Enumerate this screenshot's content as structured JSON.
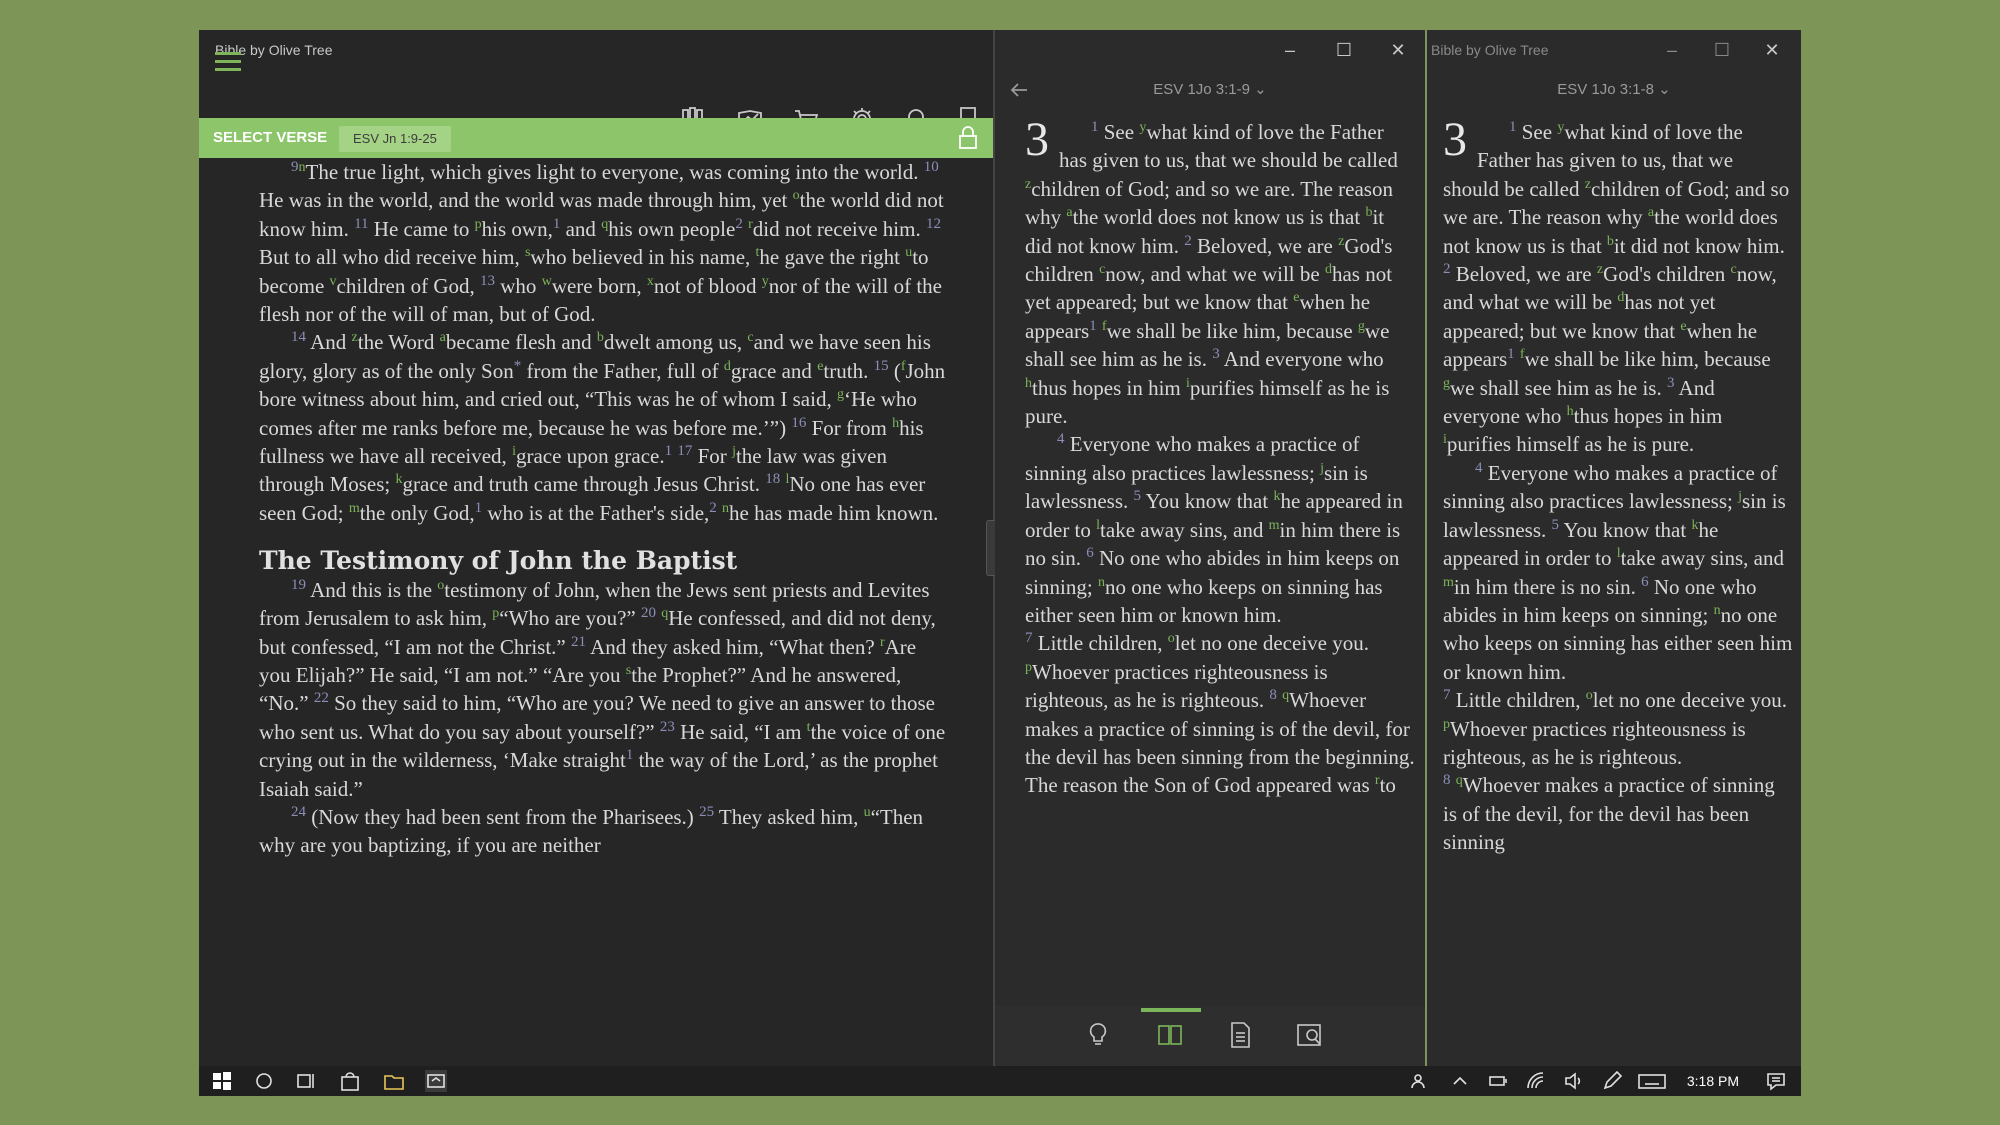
{
  "left_window": {
    "title": "Bible by Olive Tree",
    "select_verse_label": "SELECT VERSE",
    "reference": "ESV Jn 1:9-25",
    "paragraphs": [
      {
        "parts": [
          {
            "vn": "9"
          },
          {
            "fn": "n"
          },
          {
            "t": "The true light, which gives light to everyone, was coming into the world. "
          },
          {
            "vn": "10"
          },
          {
            "t": " He was in the world, and the world was made through him, yet "
          },
          {
            "fn": "o"
          },
          {
            "t": "the world did not know him. "
          },
          {
            "vn": "11"
          },
          {
            "t": " He came to "
          },
          {
            "fn": "p"
          },
          {
            "t": "his own,"
          },
          {
            "vn": "1"
          },
          {
            "t": " and "
          },
          {
            "fn": "q"
          },
          {
            "t": "his own people"
          },
          {
            "vn": "2"
          },
          {
            "t": " "
          },
          {
            "fn": "r"
          },
          {
            "t": "did not receive him. "
          },
          {
            "vn": "12"
          },
          {
            "t": " But to all who did receive him, "
          },
          {
            "fn": "s"
          },
          {
            "t": "who believed in his name, "
          },
          {
            "fn": "t"
          },
          {
            "t": "he gave the right "
          },
          {
            "fn": "u"
          },
          {
            "t": "to become "
          },
          {
            "fn": "v"
          },
          {
            "t": "children of God, "
          },
          {
            "vn": "13"
          },
          {
            "t": " who "
          },
          {
            "fn": "w"
          },
          {
            "t": "were born, "
          },
          {
            "fn": "x"
          },
          {
            "t": "not of blood "
          },
          {
            "fn": "y"
          },
          {
            "t": "nor of the will of the flesh nor of the will of man, but of God."
          }
        ]
      },
      {
        "parts": [
          {
            "vn": "14"
          },
          {
            "t": " And "
          },
          {
            "fn": "z"
          },
          {
            "t": "the Word "
          },
          {
            "fn": "a"
          },
          {
            "t": "became flesh and "
          },
          {
            "fn": "b"
          },
          {
            "t": "dwelt among us, "
          },
          {
            "fn": "c"
          },
          {
            "t": "and we have seen his glory, glory as of the only Son"
          },
          {
            "vn": "*"
          },
          {
            "t": " from the Father, full of "
          },
          {
            "fn": "d"
          },
          {
            "t": "grace and "
          },
          {
            "fn": "e"
          },
          {
            "t": "truth. "
          },
          {
            "vn": "15"
          },
          {
            "t": " ("
          },
          {
            "fn": "f"
          },
          {
            "t": "John bore witness about him, and cried out, “This was he of whom I said, "
          },
          {
            "fn": "g"
          },
          {
            "t": "‘He who comes after me ranks before me, because he was before me.’”) "
          },
          {
            "vn": "16"
          },
          {
            "t": " For from "
          },
          {
            "fn": "h"
          },
          {
            "t": "his fullness we have all received, "
          },
          {
            "fn": "i"
          },
          {
            "t": "grace upon grace."
          },
          {
            "vn": "1"
          },
          {
            "t": " "
          },
          {
            "vn": "17"
          },
          {
            "t": " For "
          },
          {
            "fn": "j"
          },
          {
            "t": "the law was given through Moses; "
          },
          {
            "fn": "k"
          },
          {
            "t": "grace and truth came through Jesus Christ. "
          },
          {
            "vn": "18"
          },
          {
            "t": " "
          },
          {
            "fn": "l"
          },
          {
            "t": "No one has ever seen God; "
          },
          {
            "fn": "m"
          },
          {
            "t": "the only God,"
          },
          {
            "vn": "1"
          },
          {
            "t": " who is at the Father's side,"
          },
          {
            "vn": "2"
          },
          {
            "t": " "
          },
          {
            "fn": "n"
          },
          {
            "t": "he has made him known."
          }
        ]
      }
    ],
    "heading": "The Testimony of John the Baptist",
    "paragraphs2": [
      {
        "parts": [
          {
            "vn": "19"
          },
          {
            "t": " And this is the "
          },
          {
            "fn": "o"
          },
          {
            "t": "testimony of John, when the Jews sent priests and Levites from Jerusalem to ask him, "
          },
          {
            "fn": "p"
          },
          {
            "t": "“Who are you?” "
          },
          {
            "vn": "20"
          },
          {
            "t": " "
          },
          {
            "fn": "q"
          },
          {
            "t": "He confessed, and did not deny, but confessed, “I am not the Christ.” "
          },
          {
            "vn": "21"
          },
          {
            "t": " And they asked him, “What then? "
          },
          {
            "fn": "r"
          },
          {
            "t": "Are you Elijah?” He said, “I am not.” “Are you "
          },
          {
            "fn": "s"
          },
          {
            "t": "the Prophet?” And he answered, “No.” "
          },
          {
            "vn": "22"
          },
          {
            "t": " So they said to him, “Who are you? We need to give an answer to those who sent us. What do you say about yourself?” "
          },
          {
            "vn": "23"
          },
          {
            "t": " He said, “I am "
          },
          {
            "fn": "t"
          },
          {
            "t": "the voice of one crying out in the wilderness, ‘Make straight"
          },
          {
            "vn": "1"
          },
          {
            "t": " the way of the Lord,’ as the prophet Isaiah said.”"
          }
        ]
      },
      {
        "parts": [
          {
            "vn": "24"
          },
          {
            "t": " (Now they had been sent from the Pharisees.) "
          },
          {
            "vn": "25"
          },
          {
            "t": " They asked him, "
          },
          {
            "fn": "u"
          },
          {
            "t": "“Then why are you baptizing, if you are neither"
          }
        ]
      }
    ]
  },
  "middle_window": {
    "reference": "ESV 1Jo 3:1-9 ⌄",
    "chapter": "3",
    "paragraphs": [
      {
        "parts": [
          {
            "vn": "1"
          },
          {
            "t": " See "
          },
          {
            "fn": "y"
          },
          {
            "t": "what kind of love the Father has given to us, that we should be called "
          },
          {
            "fn": "z"
          },
          {
            "t": "children of God; and so we are. The reason why "
          },
          {
            "fn": "a"
          },
          {
            "t": "the world does not know us is that "
          },
          {
            "fn": "b"
          },
          {
            "t": "it did not know him. "
          },
          {
            "vn": "2"
          },
          {
            "t": " Beloved, we are "
          },
          {
            "fn": "z"
          },
          {
            "t": "God's children "
          },
          {
            "fn": "c"
          },
          {
            "t": "now, and what we will be "
          },
          {
            "fn": "d"
          },
          {
            "t": "has not yet appeared; but we know that "
          },
          {
            "fn": "e"
          },
          {
            "t": "when he appears"
          },
          {
            "vn": "1"
          },
          {
            "t": " "
          },
          {
            "fn": "f"
          },
          {
            "t": "we shall be like him, because "
          },
          {
            "fn": "g"
          },
          {
            "t": "we shall see him as he is. "
          },
          {
            "vn": "3"
          },
          {
            "t": " And everyone who "
          },
          {
            "fn": "h"
          },
          {
            "t": "thus hopes in him "
          },
          {
            "fn": "i"
          },
          {
            "t": "purifies himself as he is pure."
          }
        ]
      },
      {
        "parts": [
          {
            "vn": "4"
          },
          {
            "t": " Everyone who makes a practice of sinning also practices lawlessness; "
          },
          {
            "fn": "j"
          },
          {
            "t": "sin is lawlessness. "
          },
          {
            "vn": "5"
          },
          {
            "t": " You know that "
          },
          {
            "fn": "k"
          },
          {
            "t": "he appeared in order to "
          },
          {
            "fn": "l"
          },
          {
            "t": "take away sins, and "
          },
          {
            "fn": "m"
          },
          {
            "t": "in him there is no sin. "
          },
          {
            "vn": "6"
          },
          {
            "t": " No one who abides in him keeps on sinning; "
          },
          {
            "fn": "n"
          },
          {
            "t": "no one who keeps on sinning has either seen him or known him."
          }
        ]
      },
      {
        "ni": true,
        "parts": [
          {
            "vn": "7"
          },
          {
            "t": " Little children, "
          },
          {
            "fn": "o"
          },
          {
            "t": "let no one deceive you. "
          },
          {
            "fn": "p"
          },
          {
            "t": "Whoever practices righteousness is righteous, as he is righteous. "
          },
          {
            "vn": "8"
          },
          {
            "t": " "
          },
          {
            "fn": "q"
          },
          {
            "t": "Whoever makes a practice of sinning is of the devil, for the devil has been sinning from the beginning. The reason the Son of God appeared was "
          },
          {
            "fn": "r"
          },
          {
            "t": "to"
          }
        ]
      }
    ]
  },
  "right_window": {
    "title": "Bible by Olive Tree",
    "reference": "ESV 1Jo 3:1-8 ⌄",
    "chapter": "3",
    "paragraphs": [
      {
        "parts": [
          {
            "vn": "1"
          },
          {
            "t": " See "
          },
          {
            "fn": "y"
          },
          {
            "t": "what kind of love the Father has given to us, that we should be called "
          },
          {
            "fn": "z"
          },
          {
            "t": "children of God; and so we are. The reason why "
          },
          {
            "fn": "a"
          },
          {
            "t": "the world does not know us is that "
          },
          {
            "fn": "b"
          },
          {
            "t": "it did not know him. "
          },
          {
            "vn": "2"
          },
          {
            "t": " Beloved, we are "
          },
          {
            "fn": "z"
          },
          {
            "t": "God's children "
          },
          {
            "fn": "c"
          },
          {
            "t": "now, and what we will be "
          },
          {
            "fn": "d"
          },
          {
            "t": "has not yet appeared; but we know that "
          },
          {
            "fn": "e"
          },
          {
            "t": "when he appears"
          },
          {
            "vn": "1"
          },
          {
            "t": " "
          },
          {
            "fn": "f"
          },
          {
            "t": "we shall be like him, because "
          },
          {
            "fn": "g"
          },
          {
            "t": "we shall see him as he is. "
          },
          {
            "vn": "3"
          },
          {
            "t": " And everyone who "
          },
          {
            "fn": "h"
          },
          {
            "t": "thus hopes in him "
          },
          {
            "fn": "i"
          },
          {
            "t": "purifies himself as he is pure."
          }
        ]
      },
      {
        "parts": [
          {
            "vn": "4"
          },
          {
            "t": " Everyone who makes a practice of sinning also practices lawlessness; "
          },
          {
            "fn": "j"
          },
          {
            "t": "sin is lawlessness. "
          },
          {
            "vn": "5"
          },
          {
            "t": " You know that "
          },
          {
            "fn": "k"
          },
          {
            "t": "he appeared in order to "
          },
          {
            "fn": "l"
          },
          {
            "t": "take away sins, and "
          },
          {
            "fn": "m"
          },
          {
            "t": "in him there is no sin. "
          },
          {
            "vn": "6"
          },
          {
            "t": " No one who abides in him keeps on sinning; "
          },
          {
            "fn": "n"
          },
          {
            "t": "no one who keeps on sinning has either seen him or known him."
          }
        ]
      },
      {
        "ni": true,
        "parts": [
          {
            "vn": "7"
          },
          {
            "t": " Little children, "
          },
          {
            "fn": "o"
          },
          {
            "t": "let no one deceive you. "
          },
          {
            "fn": "p"
          },
          {
            "t": "Whoever practices righteousness is righteous, as he is righteous."
          }
        ]
      },
      {
        "ni": true,
        "parts": [
          {
            "vn": "8"
          },
          {
            "t": " "
          },
          {
            "fn": "q"
          },
          {
            "t": "Whoever makes a practice of sinning is of the devil, for the devil has been sinning"
          }
        ]
      }
    ]
  },
  "taskbar": {
    "clock": "3:18 PM"
  },
  "colors": {
    "accent": "#8dc56b",
    "background": "#7d9658",
    "verse_number": "#8b8fb8"
  }
}
